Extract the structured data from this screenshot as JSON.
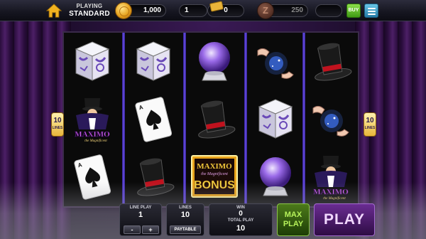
{
  "header": {
    "mode_label": "PLAYING",
    "mode_value": "STANDARD",
    "coins": "1,000",
    "level": "1",
    "tickets": "0",
    "points": "250",
    "extra": "",
    "buy_label": "BUY"
  },
  "reels": {
    "side_lines_number": "10",
    "side_lines_label": "LINES",
    "columns": [
      [
        "magic-box",
        "magician-maximo",
        "ace-of-spades"
      ],
      [
        "magic-box",
        "ace-of-spades",
        "top-hat"
      ],
      [
        "crystal-ball",
        "top-hat",
        "bonus"
      ],
      [
        "magic-hands",
        "magic-box",
        "crystal-ball"
      ],
      [
        "top-hat",
        "magic-hands",
        "magician-maximo"
      ]
    ],
    "maximo_text": "MAXIMO",
    "maximo_sub": "the Magnificent",
    "bonus_title": "MAXIMO",
    "bonus_sub": "the Magnificent",
    "bonus_word": "BONUS"
  },
  "controls": {
    "line_play_label": "LINE PLAY",
    "line_play_value": "1",
    "minus": "-",
    "plus": "+",
    "lines_label": "LINES",
    "lines_value": "10",
    "paytable_label": "PAYTABLE",
    "win_label": "WIN",
    "win_value": "0",
    "total_play_label": "TOTAL PLAY",
    "total_play_value": "10",
    "max_play_line1": "MAX",
    "max_play_line2": "PLAY",
    "play_label": "PLAY"
  },
  "colors": {
    "reel_separator": "#6a52e6",
    "curtain": "#4c1f66",
    "play_button": "#6a2c92",
    "max_play_button": "#4c7a1a"
  }
}
